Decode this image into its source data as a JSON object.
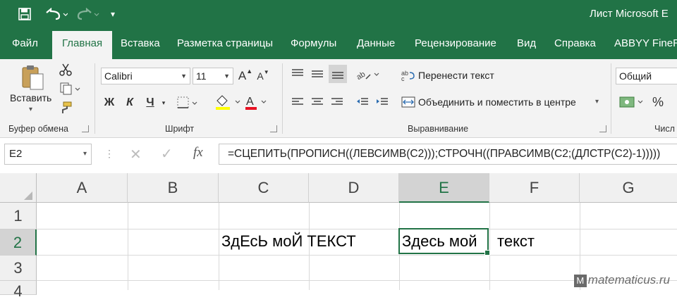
{
  "title_bar": {
    "title": "Лист Microsoft E"
  },
  "tabs": [
    "Файл",
    "Главная",
    "Вставка",
    "Разметка страницы",
    "Формулы",
    "Данные",
    "Рецензирование",
    "Вид",
    "Справка",
    "ABBYY FineRe"
  ],
  "active_tab": "Главная",
  "ribbon": {
    "clipboard": {
      "paste_label": "Вставить",
      "group_label": "Буфер обмена"
    },
    "font": {
      "font_name": "Calibri",
      "font_size": "11",
      "bold": "Ж",
      "italic": "К",
      "underline": "Ч",
      "group_label": "Шрифт"
    },
    "alignment": {
      "wrap_text": "Перенести текст",
      "merge_center": "Объединить и поместить в центре",
      "group_label": "Выравнивание"
    },
    "number": {
      "format": "Общий",
      "group_label": "Числ"
    }
  },
  "formula_bar": {
    "name_box": "E2",
    "fx": "fx",
    "formula": "=СЦЕПИТЬ(ПРОПИСН((ЛЕВСИМВ(C2)));СТРОЧН((ПРАВСИМВ(C2;(ДЛСТР(C2)-1)))))"
  },
  "grid": {
    "columns": [
      "A",
      "B",
      "C",
      "D",
      "E",
      "F",
      "G"
    ],
    "rows": [
      "1",
      "2",
      "3",
      "4"
    ],
    "selected_column": "E",
    "selected_row": "2",
    "cells": {
      "C2": "ЗдЕсЬ моЙ ТЕКСТ",
      "E2": "Здесь мой",
      "F2": "текст"
    }
  },
  "watermark": "matematicus.ru",
  "colors": {
    "accent": "#217346",
    "ribbon_bg": "#f3f3f3",
    "header_bg": "#f0f0f0"
  }
}
